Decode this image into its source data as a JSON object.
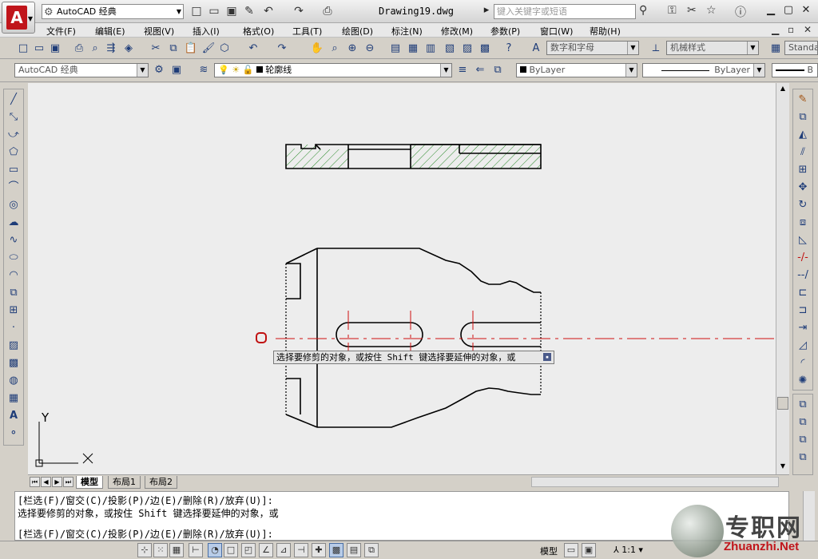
{
  "app": {
    "workspace": "AutoCAD 经典",
    "title": "Drawing19.dwg",
    "search_placeholder": "键入关键字或短语"
  },
  "menu": [
    "文件(F)",
    "编辑(E)",
    "视图(V)",
    "插入(I)",
    "格式(O)",
    "工具(T)",
    "绘图(D)",
    "标注(N)",
    "修改(M)",
    "参数(P)",
    "窗口(W)",
    "帮助(H)"
  ],
  "toolbar": {
    "text_style": "数字和字母",
    "dim_style": "机械样式",
    "table_style": "Standa"
  },
  "toolbar2": {
    "workspace": "AutoCAD 经典",
    "layer": "轮廓线",
    "color": "ByLayer",
    "linetype": "ByLayer",
    "lineweight": "B"
  },
  "ucs": {
    "y_label": "Y",
    "x_label": "X"
  },
  "tooltip": "选择要修剪的对象，或按住 Shift 键选择要延伸的对象，或",
  "tabs": {
    "model": "模型",
    "layout1": "布局1",
    "layout2": "布局2"
  },
  "command": {
    "line1": "[栏选(F)/窗交(C)/投影(P)/边(E)/删除(R)/放弃(U)]:",
    "line2": "选择要修剪的对象，或按住 Shift 键选择要延伸的对象，或",
    "line3": "[栏选(F)/窗交(C)/投影(P)/边(E)/删除(R)/放弃(U)]:"
  },
  "status": {
    "model": "模型",
    "scale": "1:1"
  },
  "watermark": {
    "cn": "专职网",
    "url": "Zhuanzhi.Net"
  },
  "colors": {
    "accent": "#c0151b",
    "drawing_bg": "#ededed",
    "hatch": "#2a8a2a",
    "centerline": "#d01010"
  }
}
